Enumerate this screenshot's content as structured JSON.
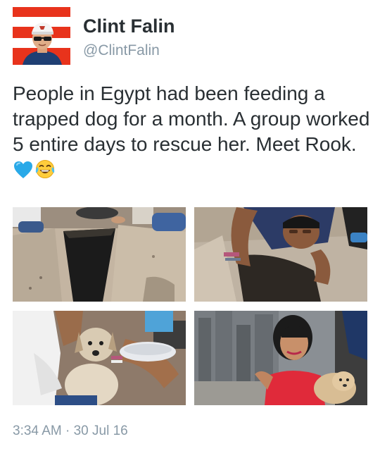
{
  "user": {
    "name": "Clint Falin",
    "handle": "@ClintFalin"
  },
  "tweet": {
    "text": "People in Egypt had been feeding a trapped dog for a month. A group worked 5 entire days to rescue her. Meet Rook.",
    "emojis": [
      "blue-heart-icon",
      "crying-laughing-face-icon"
    ],
    "timestamp": "3:34 AM · 30 Jul 16"
  },
  "media": [
    {
      "name": "photo-hole-in-ground"
    },
    {
      "name": "photo-man-reaching-into-hole"
    },
    {
      "name": "photo-dog-being-fed"
    },
    {
      "name": "photo-woman-holding-dog"
    }
  ],
  "colors": {
    "name_text": "#292f33",
    "secondary_text": "#8899a6",
    "heart": "#29a9e8",
    "avatar_stripe": "#e8331c"
  }
}
